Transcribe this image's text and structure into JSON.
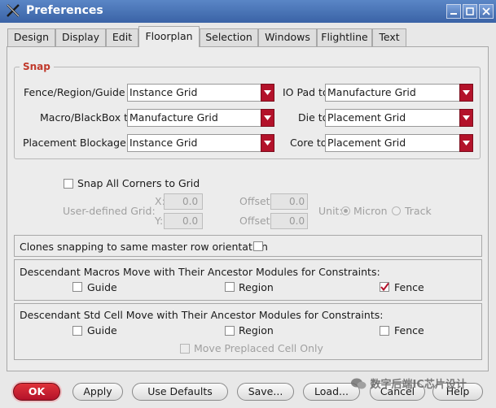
{
  "window": {
    "title": "Preferences"
  },
  "tabs": [
    "Design",
    "Display",
    "Edit",
    "Floorplan",
    "Selection",
    "Windows",
    "Flightline",
    "Text"
  ],
  "active_tab": "Floorplan",
  "snap": {
    "title": "Snap",
    "rows": [
      {
        "left_label": "Fence/Region/Guide to",
        "left_value": "Instance Grid",
        "right_label": "IO Pad to",
        "right_value": "Manufacture Grid"
      },
      {
        "left_label": "Macro/BlackBox to",
        "left_value": "Manufacture Grid",
        "right_label": "Die to",
        "right_value": "Placement Grid"
      },
      {
        "left_label": "Placement Blockage to",
        "left_value": "Instance Grid",
        "right_label": "Core to",
        "right_value": "Placement Grid"
      }
    ],
    "snap_all_corners": {
      "label": "Snap All Corners to Grid",
      "checked": false
    },
    "user_grid": {
      "label": "User-defined Grid:",
      "x_label": "X:",
      "x_value": "0.0",
      "y_label": "Y:",
      "y_value": "0.0",
      "offset_label": "Offset:",
      "offset_x": "0.0",
      "offset_y": "0.0",
      "unit_label": "Unit:",
      "unit_options": [
        "Micron",
        "Track"
      ],
      "unit_selected": "Micron"
    }
  },
  "clones": {
    "label": "Clones snapping to same master row orientation",
    "checked": false
  },
  "macros": {
    "title": "Descendant Macros Move with Their Ancestor Modules for Constraints:",
    "options": [
      {
        "label": "Guide",
        "checked": false
      },
      {
        "label": "Region",
        "checked": false
      },
      {
        "label": "Fence",
        "checked": true
      }
    ]
  },
  "stdcell": {
    "title": "Descendant Std Cell Move with Their Ancestor Modules for Constraints:",
    "options": [
      {
        "label": "Guide",
        "checked": false
      },
      {
        "label": "Region",
        "checked": false
      },
      {
        "label": "Fence",
        "checked": false
      }
    ],
    "move_preplaced": {
      "label": "Move Preplaced Cell Only",
      "checked": false
    }
  },
  "buttons": {
    "ok": "OK",
    "apply": "Apply",
    "use_defaults": "Use Defaults",
    "save": "Save...",
    "load": "Load...",
    "cancel": "Cancel",
    "help": "Help"
  },
  "watermark": "数字后端IC芯片设计",
  "colors": {
    "accent": "#b3122a",
    "title_bar": "#3a63a6",
    "snap_title": "#c0392b"
  }
}
